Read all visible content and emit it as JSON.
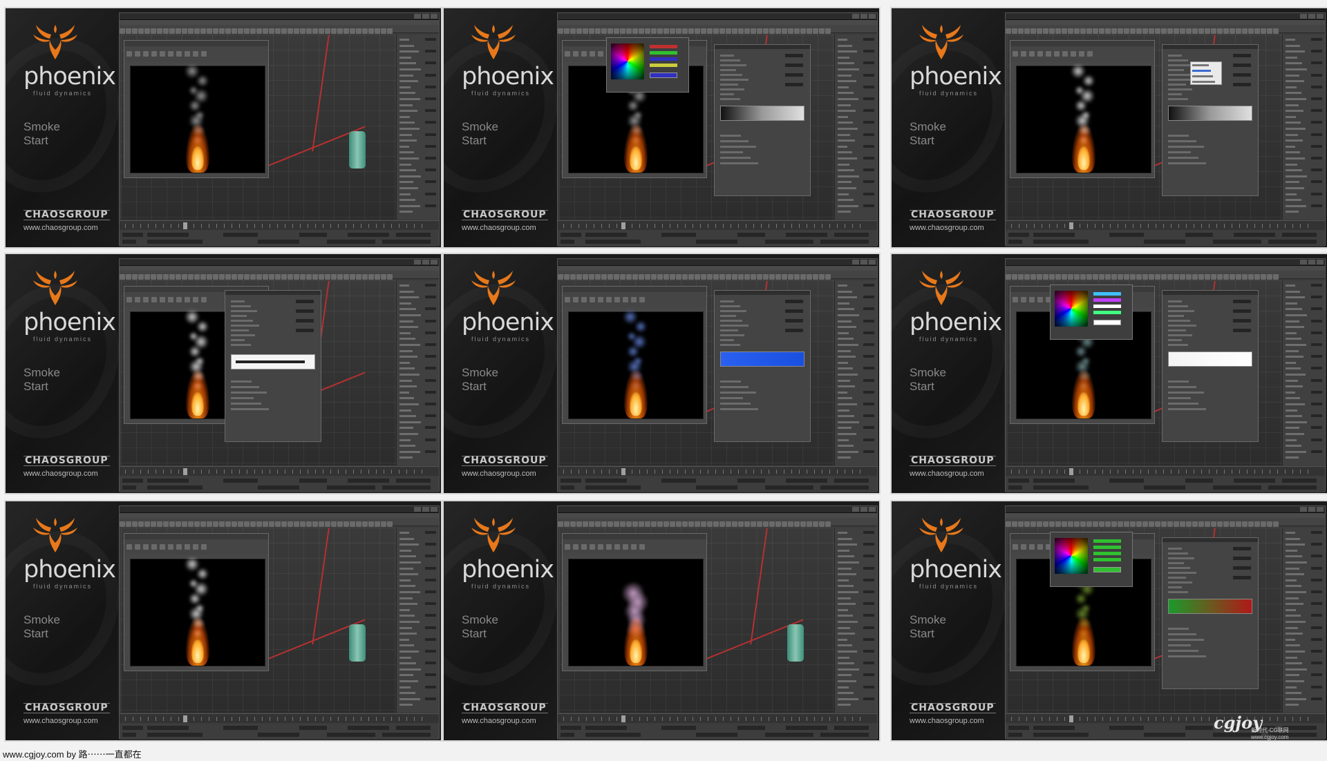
{
  "brand": {
    "logo_word": "phoenix",
    "logo_sub": "fluid dynamics",
    "lesson_line1": "Smoke",
    "lesson_line2": "Start",
    "company": "CHAOSGROUP",
    "url": "www.chaosgroup.com"
  },
  "tiles": [
    {
      "id": 1,
      "render": "fire-gray-smoke",
      "dialog": "none",
      "smoke_color": "#9a9a9a",
      "fire_color": "#ff9a1a"
    },
    {
      "id": 2,
      "render": "fire-gray-smoke",
      "dialog": "color-picker-gray-ramp",
      "smoke_color": "#9a9a9a",
      "fire_color": "#ff9a1a"
    },
    {
      "id": 3,
      "render": "fire-white-smoke",
      "dialog": "dropdown-gray-ramp",
      "smoke_color": "#d8d8d8",
      "fire_color": "#ff9a1a"
    },
    {
      "id": 4,
      "render": "fire-white-smoke",
      "dialog": "value-entry",
      "smoke_color": "#d8d8d8",
      "fire_color": "#ff9a1a"
    },
    {
      "id": 5,
      "render": "fire-blue-smoke",
      "dialog": "blue-ramp",
      "smoke_color": "#5a78c8",
      "fire_color": "#ff9a1a"
    },
    {
      "id": 6,
      "render": "fire-teal-smoke",
      "dialog": "color-picker-white-ramp",
      "smoke_color": "#6f8f92",
      "fire_color": "#ff9a1a"
    },
    {
      "id": 7,
      "render": "fire-white-smoke",
      "dialog": "none",
      "smoke_color": "#d8d8d8",
      "fire_color": "#ff9a1a"
    },
    {
      "id": 8,
      "render": "fire-pink-smoke",
      "dialog": "none",
      "smoke_color": "#c8a0c8",
      "fire_color": "#ff9a1a"
    },
    {
      "id": 9,
      "render": "fire-green-smoke",
      "dialog": "color-picker-green-red-ramp",
      "smoke_color": "#6b8a2a",
      "fire_color": "#ffb020"
    }
  ],
  "colors": {
    "sheet_bg": "#f2f2f2",
    "logo_orange": "#e8781a",
    "ramp_blue": "#1a50e0",
    "ramp_green": "#1a9a2a",
    "ramp_red": "#b01818"
  },
  "caption": "www.cgjoy.com by 路⋯⋯一直都在",
  "watermark": {
    "main": "cgjoy",
    "sub": "新时代·CG联网 www.cgjoy.com"
  }
}
